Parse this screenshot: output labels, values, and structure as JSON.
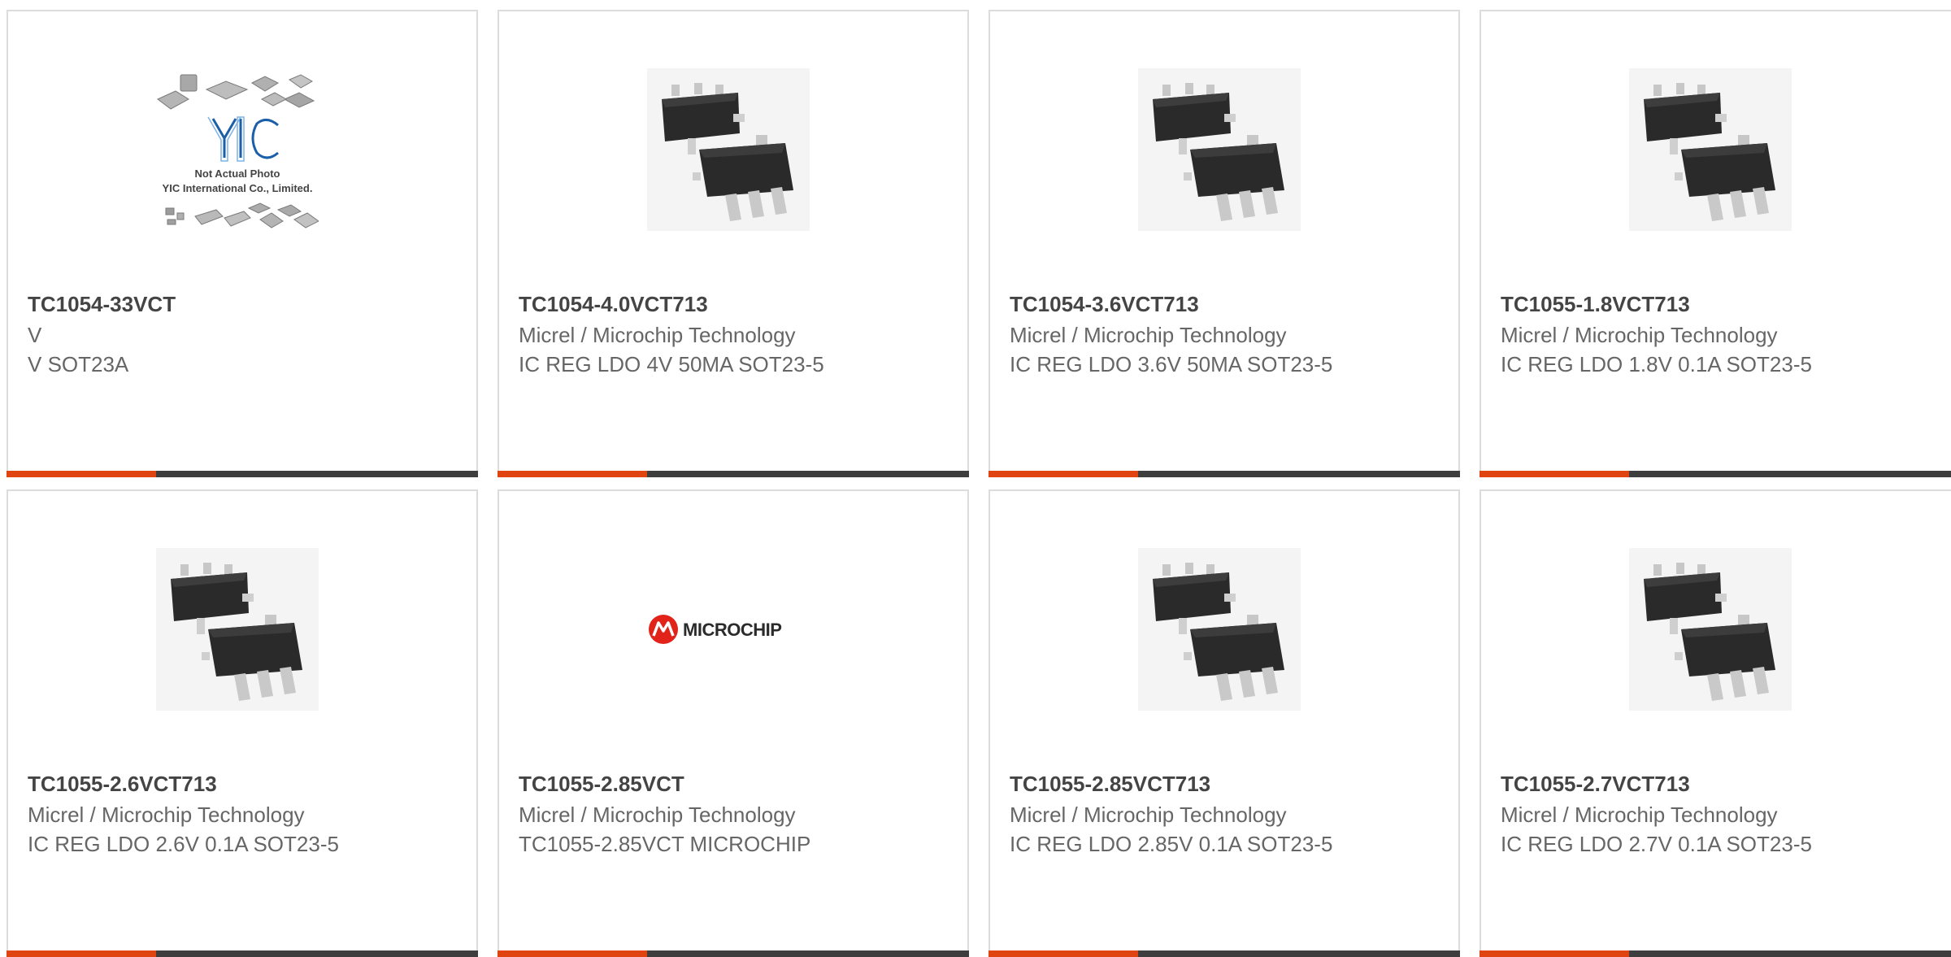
{
  "products": [
    {
      "part_number": "TC1054-33VCT",
      "manufacturer": "V",
      "description": "V SOT23A",
      "image": "generic-ic-packages-photo",
      "image_caption_line1": "Not Actual Photo",
      "image_caption_line2": "YIC International Co., Limited."
    },
    {
      "part_number": "TC1054-4.0VCT713",
      "manufacturer": "Micrel / Microchip Technology",
      "description": "IC REG LDO 4V 50MA SOT23-5",
      "image": "sot23-5-package-photo"
    },
    {
      "part_number": "TC1054-3.6VCT713",
      "manufacturer": "Micrel / Microchip Technology",
      "description": "IC REG LDO 3.6V 50MA SOT23-5",
      "image": "sot23-5-package-photo"
    },
    {
      "part_number": "TC1055-1.8VCT713",
      "manufacturer": "Micrel / Microchip Technology",
      "description": "IC REG LDO 1.8V 0.1A SOT23-5",
      "image": "sot23-5-package-photo"
    },
    {
      "part_number": "TC1055-2.6VCT713",
      "manufacturer": "Micrel / Microchip Technology",
      "description": "IC REG LDO 2.6V 0.1A SOT23-5",
      "image": "sot23-5-package-photo"
    },
    {
      "part_number": "TC1055-2.85VCT",
      "manufacturer": "Micrel / Microchip Technology",
      "description": "TC1055-2.85VCT MICROCHIP",
      "image": "microchip-logo",
      "logo_text": "MICROCHIP"
    },
    {
      "part_number": "TC1055-2.85VCT713",
      "manufacturer": "Micrel / Microchip Technology",
      "description": "IC REG LDO 2.85V 0.1A SOT23-5",
      "image": "sot23-5-package-photo"
    },
    {
      "part_number": "TC1055-2.7VCT713",
      "manufacturer": "Micrel / Microchip Technology",
      "description": "IC REG LDO 2.7V 0.1A SOT23-5",
      "image": "sot23-5-package-photo"
    }
  ],
  "colors": {
    "accent": "#e04411",
    "bar": "#3e3e3e",
    "border": "#dcdcdc",
    "part_number_text": "#444444",
    "body_text": "#666666"
  }
}
